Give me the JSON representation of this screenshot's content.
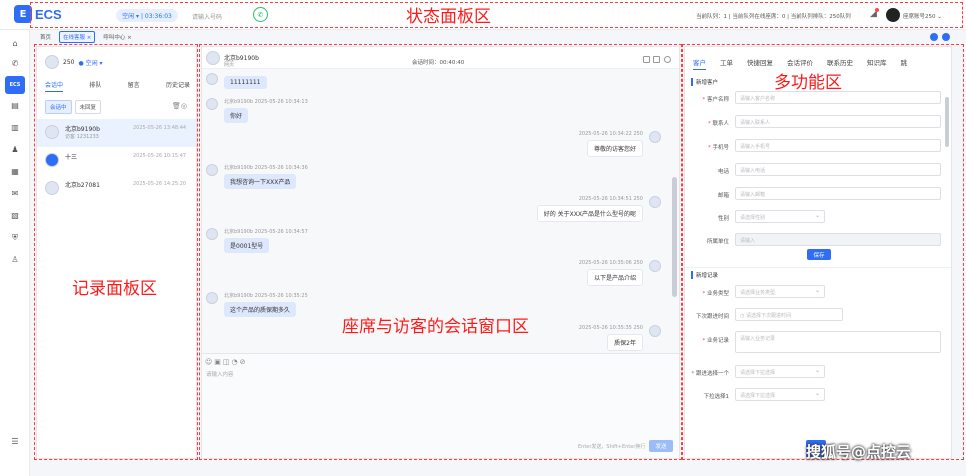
{
  "app": {
    "logo_text": "ECS",
    "logo_mark": "E"
  },
  "topbar": {
    "status_label": "空闲 ▾ | 03:36:03",
    "dial_placeholder": "请输入号码",
    "queue_info": "当前队列：1 | 当前队列在线座席：0 | 当前队列排队：250队列",
    "user_name": "座席账号250 ⌄"
  },
  "page_tabs": [
    {
      "label": "首页"
    },
    {
      "label": "在线客服 ×"
    },
    {
      "label": "呼叫中心 ×"
    }
  ],
  "record_panel": {
    "agent_name": "250",
    "agent_status": "● 空闲 ▾",
    "tabs": [
      "会话中",
      "排队",
      "留言",
      "历史记录"
    ],
    "sub_tabs": [
      "会话中",
      "未回复"
    ],
    "items": [
      {
        "name": "北京b9190b",
        "sub": "访客 1231233",
        "time": "2025-05-26 13:48:44"
      },
      {
        "name": "十三",
        "sub": "",
        "time": "2025-05-26 10:15:47"
      },
      {
        "name": "北京b27081",
        "sub": "",
        "time": "2025-05-26 14:25:20"
      }
    ]
  },
  "chat": {
    "visitor_name": "北京b9190b",
    "visitor_sub": "网页",
    "duration": "会话时间：00:40:40",
    "messages": [
      {
        "dir": "in",
        "meta": "",
        "text": "11111111"
      },
      {
        "dir": "in",
        "meta": "北京b9190b  2025-05-26 10:34:13",
        "text": "你好"
      },
      {
        "dir": "out",
        "meta": "2025-05-26 10:34:22  250",
        "text": "尊敬的访客您好"
      },
      {
        "dir": "in",
        "meta": "北京b9190b  2025-05-26 10:34:36",
        "text": "我想咨询一下XXX产品"
      },
      {
        "dir": "out",
        "meta": "2025-05-26 10:34:51  250",
        "text": "好的 关于XXX产品是什么型号的呢"
      },
      {
        "dir": "in",
        "meta": "北京b9190b  2025-05-26 10:34:57",
        "text": "是0001型号"
      },
      {
        "dir": "out",
        "meta": "2025-05-26 10:35:06  250",
        "text": "以下是产品介绍"
      },
      {
        "dir": "in",
        "meta": "北京b9190b  2025-05-26 10:35:25",
        "text": "这个产品的质保期多久"
      },
      {
        "dir": "out",
        "meta": "2025-05-26 10:35:35  250",
        "text": "质保2年"
      }
    ],
    "input_placeholder": "请输入内容",
    "send_hint": "Enter发送，Shift+Enter换行",
    "send_label": "发送"
  },
  "multi_panel": {
    "tabs": [
      "客户",
      "工单",
      "快捷回复",
      "会话评价",
      "联系历史",
      "知识库",
      "跳"
    ],
    "section_customer": "新增客户",
    "customer_fields": [
      {
        "label": "客户名称",
        "required": true,
        "placeholder": "请输入客户名称",
        "kind": "input"
      },
      {
        "label": "联系人",
        "required": true,
        "placeholder": "请输入联系人",
        "kind": "input"
      },
      {
        "label": "手机号",
        "required": true,
        "placeholder": "请输入手机号",
        "kind": "input"
      },
      {
        "label": "电话",
        "required": false,
        "placeholder": "请输入电话",
        "kind": "input"
      },
      {
        "label": "邮箱",
        "required": false,
        "placeholder": "请输入邮箱",
        "kind": "input"
      },
      {
        "label": "性别",
        "required": false,
        "placeholder": "请选择性别",
        "kind": "select"
      },
      {
        "label": "所属单位",
        "required": false,
        "placeholder": "请输入",
        "kind": "disabled"
      }
    ],
    "save_label": "保存",
    "section_followup": "新增记录",
    "followup_fields": [
      {
        "label": "业务类型",
        "required": true,
        "placeholder": "请选择业务类型",
        "kind": "select"
      },
      {
        "label": "下次跟进时间",
        "required": false,
        "placeholder": "◷ 请选择下次跟进时间",
        "kind": "input"
      },
      {
        "label": "业务记录",
        "required": true,
        "placeholder": "请输入业务记录",
        "kind": "area"
      },
      {
        "label": "跟进选择一个",
        "required": true,
        "placeholder": "请选择下拉选择",
        "kind": "select"
      },
      {
        "label": "下拉选择1",
        "required": false,
        "placeholder": "请选择下拉选择",
        "kind": "select"
      }
    ]
  },
  "annotations": {
    "status_zone": "状态面板区",
    "record_zone": "记录面板区",
    "chat_zone": "座席与访客的会话窗口区",
    "multi_zone": "多功能区"
  },
  "watermark": "搜狐号@点控云",
  "colors": {
    "accent": "#2f6df6",
    "annotation": "#ff1a1a"
  }
}
